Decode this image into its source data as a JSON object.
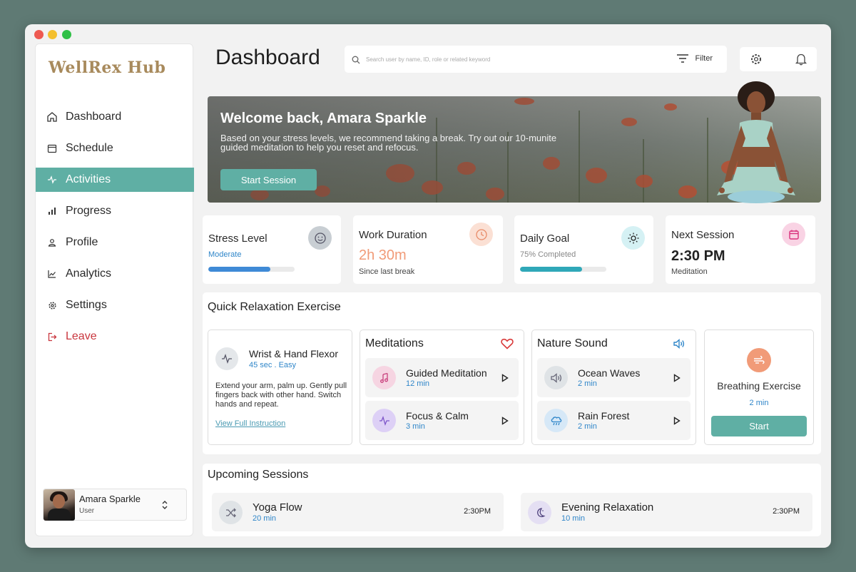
{
  "app": {
    "logo": "WellRex Hub"
  },
  "sidebar": {
    "items": [
      {
        "label": "Dashboard",
        "icon": "home-icon",
        "active": false
      },
      {
        "label": "Schedule",
        "icon": "calendar-icon",
        "active": false
      },
      {
        "label": "Activities",
        "icon": "pulse-icon",
        "active": true
      },
      {
        "label": "Progress",
        "icon": "bar-chart-icon",
        "active": false
      },
      {
        "label": "Profile",
        "icon": "user-icon",
        "active": false
      },
      {
        "label": "Analytics",
        "icon": "line-chart-icon",
        "active": false
      },
      {
        "label": "Settings",
        "icon": "gear-icon",
        "active": false
      },
      {
        "label": "Leave",
        "icon": "logout-icon",
        "active": false
      }
    ],
    "user": {
      "name": "Amara Sparkle",
      "role": "User"
    }
  },
  "header": {
    "title": "Dashboard",
    "search_placeholder": "Search user by name, ID, role or related keyword",
    "filter_label": "Filter"
  },
  "banner": {
    "heading": "Welcome back, Amara Sparkle",
    "text": "Based on your stress levels, we recommend taking a break. Try out our 10-munite guided meditation to help you reset and refocus.",
    "button": "Start Session"
  },
  "stats": {
    "stress": {
      "title": "Stress Level",
      "value": "Moderate",
      "progress": 0.72
    },
    "work": {
      "title": "Work Duration",
      "value": "2h 30m",
      "note": "Since last break"
    },
    "goal": {
      "title": "Daily Goal",
      "value": "75% Completed",
      "progress": 0.72
    },
    "next": {
      "title": "Next Session",
      "value": "2:30 PM",
      "note": "Meditation"
    }
  },
  "quick": {
    "title": "Quick Relaxation Exercise",
    "wrist": {
      "title": "Wrist & Hand Flexor",
      "meta": "45 sec . Easy",
      "description": "Extend your arm, palm up. Gently pull fingers back with other hand. Switch hands and repeat.",
      "link": "View Full Instruction"
    },
    "meditations": {
      "title": "Meditations",
      "items": [
        {
          "name": "Guided Meditation",
          "duration": "12 min"
        },
        {
          "name": "Focus & Calm",
          "duration": "3 min"
        }
      ]
    },
    "nature": {
      "title": "Nature Sound",
      "items": [
        {
          "name": "Ocean Waves",
          "duration": "2 min"
        },
        {
          "name": "Rain Forest",
          "duration": "2 min"
        }
      ]
    },
    "breathing": {
      "title": "Breathing Exercise",
      "duration": "2 min",
      "button": "Start"
    }
  },
  "upcoming": {
    "title": "Upcoming  Sessions",
    "items": [
      {
        "name": "Yoga Flow",
        "duration": "20 min",
        "time": "2:30PM"
      },
      {
        "name": "Evening Relaxation",
        "duration": "10 min",
        "time": "2:30PM"
      }
    ]
  },
  "colors": {
    "accent": "#5fafa4",
    "leave": "#c9363e",
    "link_blue": "#2f86c9",
    "work_orange": "#f19b78",
    "stress_bar": "#3f8ad6",
    "goal_bar": "#2fa8b8"
  }
}
